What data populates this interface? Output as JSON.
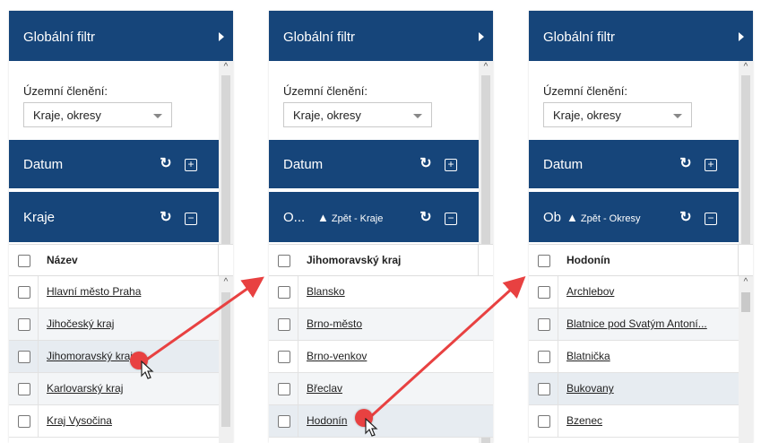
{
  "panels": [
    {
      "header": "Globální filtr",
      "territory_label": "Územní členění:",
      "select_value": "Kraje, okresy",
      "datum_label": "Datum",
      "level_title": "Kraje",
      "back_label": "",
      "column_header": "Název",
      "rows": [
        "Hlavní město Praha",
        "Jihočeský kraj",
        "Jihomoravský kraj",
        "Karlovarský kraj",
        "Kraj Vysočina"
      ]
    },
    {
      "header": "Globální filtr",
      "territory_label": "Územní členění:",
      "select_value": "Kraje, okresy",
      "datum_label": "Datum",
      "level_title": "O...",
      "back_label": "Zpět - Kraje",
      "column_header": "Jihomoravský kraj",
      "rows": [
        "Blansko",
        "Brno-město",
        "Brno-venkov",
        "Břeclav",
        "Hodonín"
      ]
    },
    {
      "header": "Globální filtr",
      "territory_label": "Územní členění:",
      "select_value": "Kraje, okresy",
      "datum_label": "Datum",
      "level_title": "Ob",
      "back_label": "Zpět - Okresy",
      "column_header": "Hodonín",
      "rows": [
        "Archlebov",
        "Blatnice pod Svatým Antoní...",
        "Blatnička",
        "Bukovany",
        "Bzenec"
      ]
    }
  ],
  "colors": {
    "header_bg": "#16457a",
    "arrow": "#e84141"
  },
  "icons": {
    "refresh": "refresh-icon",
    "expand": "plus-box-icon",
    "collapse": "minus-box-icon",
    "back": "chevron-up-icon",
    "header_arrow": "triangle-right-icon"
  }
}
